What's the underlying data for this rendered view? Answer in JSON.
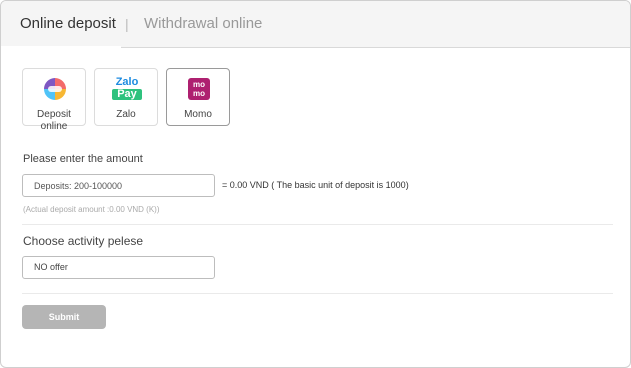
{
  "tabs": {
    "deposit_label": "Online deposit",
    "separator": "|",
    "withdraw_label": "Withdrawal online"
  },
  "methods": [
    {
      "label": "Deposit online",
      "icon": "online-banking-icon"
    },
    {
      "label": "Zalo",
      "icon": "zalopay-icon",
      "icon_text_top": "Zalo",
      "icon_text_bottom": "Pay"
    },
    {
      "label": "Momo",
      "icon": "momo-icon",
      "icon_text": "mo mo",
      "selected": true
    }
  ],
  "amount": {
    "label": "Please enter the amount",
    "placeholder": "Deposits: 200-100000",
    "conversion": "= 0.00 VND ( The basic unit of deposit is 1000)",
    "actual": "(Actual deposit amount :0.00 VND (K))"
  },
  "activity": {
    "label": "Choose activity pelese",
    "selected_value": "NO offer"
  },
  "submit_label": "Submit",
  "colors": {
    "momo": "#ae2070",
    "zalo_blue": "#1c8be0",
    "zalo_green": "#2ec27e",
    "submit_bg": "#b5b5b5"
  }
}
